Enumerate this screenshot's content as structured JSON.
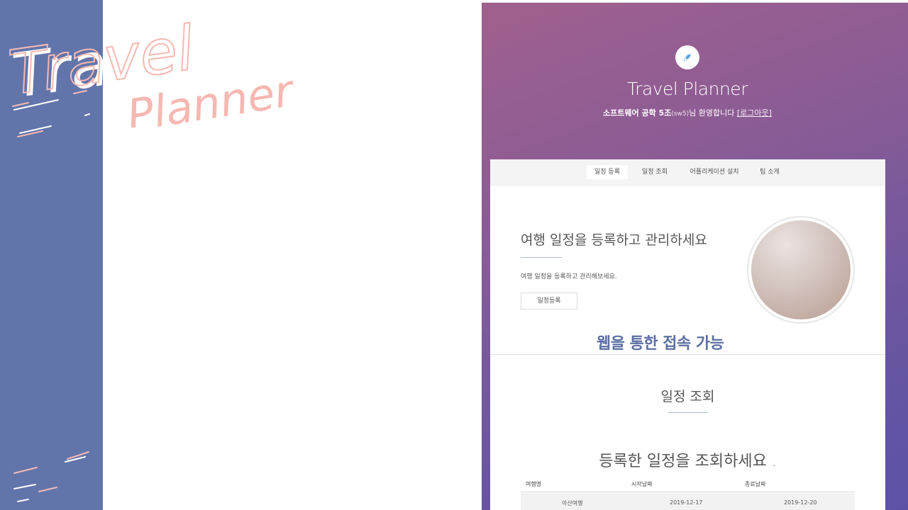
{
  "logo": {
    "word1": "Travel",
    "word2": "Planner"
  },
  "colors": {
    "side_bar": "#6275ab",
    "logo_pink": "#f6b8b2",
    "accent_blue": "#5c6fa1",
    "gradient_start": "#a0608e",
    "gradient_end": "#5b52a6"
  },
  "app": {
    "icon": "rocket-icon",
    "title": "Travel Planner",
    "welcome": {
      "user": "소프트웨어 공학 5조",
      "user_id": "(sw5)",
      "suffix": "님 환영합니다",
      "logout": "[로그아웃]"
    }
  },
  "nav": {
    "tabs": [
      {
        "label": "일정 등록",
        "active": true
      },
      {
        "label": "일정 조회",
        "active": false
      },
      {
        "label": "어플리케이션 설치",
        "active": false
      },
      {
        "label": "팀 소개",
        "active": false
      }
    ]
  },
  "register_section": {
    "title": "여행 일정을 등록하고 관리하세요",
    "description": "여행 일정을 등록하고 관리해보세요.",
    "button": "일정등록"
  },
  "annotation": "웹을 통한 접속 가능",
  "view_section": {
    "title": "일정 조회",
    "subtitle": "등록한 일정을 조회하세요 .",
    "table": {
      "headers": [
        "여행명",
        "시작날짜",
        "종료날짜"
      ],
      "rows": [
        [
          "아산여행",
          "2019-12-17",
          "2019-12-20"
        ]
      ]
    }
  }
}
